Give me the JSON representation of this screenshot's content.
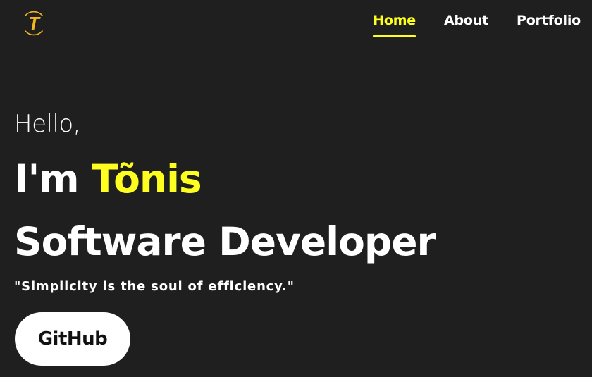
{
  "header": {
    "logo_letter": "T",
    "logo_icon": "t-letter-logo",
    "nav": [
      {
        "label": "Home",
        "active": true
      },
      {
        "label": "About",
        "active": false
      },
      {
        "label": "Portfolio",
        "active": false
      }
    ]
  },
  "hero": {
    "greeting": "Hello,",
    "intro_prefix": "I'm ",
    "name": "Tõnis",
    "role": "Software Developer",
    "quote": "\"Simplicity is the soul of efficiency.\"",
    "cta_label": "GitHub"
  },
  "colors": {
    "background": "#1f1f1f",
    "accent": "#ffff1f",
    "logo_gold": "#f5b81b",
    "text": "#ffffff",
    "button_bg": "#ffffff",
    "button_text": "#111111"
  }
}
